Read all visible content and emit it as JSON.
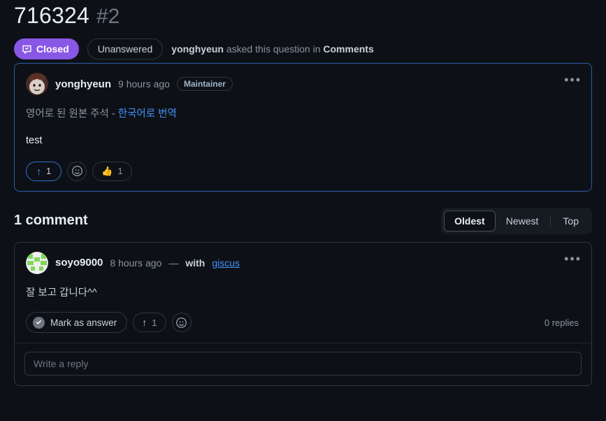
{
  "header": {
    "title": "716324",
    "number": "#2",
    "status_badge": {
      "label": "Closed",
      "icon": "discussion-closed-icon",
      "color": "#8957e5"
    },
    "answer_badge": {
      "label": "Unanswered"
    },
    "meta": {
      "author": "yonghyeun",
      "middle": " asked this question in ",
      "category": "Comments"
    }
  },
  "original_post": {
    "author": "yonghyeun",
    "timestamp": "9 hours ago",
    "role_badge": "Maintainer",
    "avatar": "cat-photo-avatar",
    "menu_icon": "kebab-horizontal-icon",
    "body_line1_muted": "영어로 된 원본 주석 - ",
    "body_line1_link": "한국어로 번역",
    "body_line2": "test",
    "reactions": [
      {
        "name": "upvote",
        "icon": "arrow-up-icon",
        "count": "1",
        "active": true
      },
      {
        "name": "add-reaction",
        "icon": "smiley-icon",
        "count": "",
        "active": false
      },
      {
        "name": "thumbs-up",
        "icon": "👍",
        "count": "1",
        "active": false
      }
    ]
  },
  "comments_section": {
    "count_label": "1 comment",
    "sort": {
      "options": [
        "Oldest",
        "Newest",
        "Top"
      ],
      "selected": "Oldest"
    }
  },
  "comment": {
    "author": "soyo9000",
    "timestamp": "8 hours ago",
    "dash": "—",
    "with_label": "with",
    "via_link": "giscus",
    "avatar": "identicon-avatar",
    "menu_icon": "kebab-horizontal-icon",
    "body": "잘 보고 갑니다^^",
    "mark_as_answer": {
      "label": "Mark as answer",
      "icon": "check-circle-icon"
    },
    "reactions": [
      {
        "name": "upvote",
        "icon": "arrow-up-icon",
        "count": "1"
      },
      {
        "name": "add-reaction",
        "icon": "smiley-icon",
        "count": ""
      }
    ],
    "replies_label": "0 replies",
    "reply_placeholder": "Write a reply"
  },
  "colors": {
    "background": "#0d1117",
    "border": "#30363d",
    "highlight_border": "#2f5ca8",
    "link": "#4493f8",
    "accent_purple": "#8957e5",
    "text_primary": "#e6edf3",
    "text_muted": "#8b949e"
  }
}
